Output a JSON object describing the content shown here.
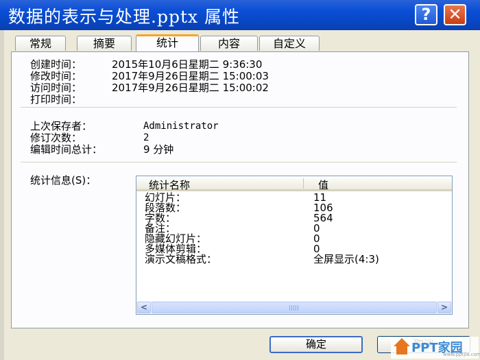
{
  "window": {
    "title": "数据的表示与处理.pptx 属性"
  },
  "titlebar_buttons": {
    "help": "?",
    "close": "✕"
  },
  "tabs": [
    {
      "label": "常规"
    },
    {
      "label": "摘要"
    },
    {
      "label": "统计"
    },
    {
      "label": "内容"
    },
    {
      "label": "自定义"
    }
  ],
  "active_tab": "统计",
  "dates": {
    "created_label": "创建时间：",
    "created_value": "2015年10月6日星期二 9:36:30",
    "modified_label": "修改时间：",
    "modified_value": "2017年9月26日星期二 15:00:03",
    "accessed_label": "访问时间：",
    "accessed_value": "2017年9月26日星期二 15:00:02",
    "printed_label": "打印时间："
  },
  "saving": {
    "last_saved_by_label": "上次保存者：",
    "last_saved_by_value": "Administrator",
    "revision_label": "修订次数：",
    "revision_value": "2",
    "edit_time_label": "编辑时间总计：",
    "edit_time_value": "9 分钟"
  },
  "stats": {
    "label": "统计信息(S)：",
    "columns": {
      "name": "统计名称",
      "value": "值"
    },
    "rows": [
      {
        "name": "幻灯片：",
        "value": "11"
      },
      {
        "name": "段落数：",
        "value": "106"
      },
      {
        "name": "字数：",
        "value": "564"
      },
      {
        "name": "备注：",
        "value": "0"
      },
      {
        "name": "隐藏幻灯片：",
        "value": "0"
      },
      {
        "name": "多媒体剪辑：",
        "value": "0"
      },
      {
        "name": "演示文稿格式：",
        "value": "全屏显示(4:3)"
      }
    ],
    "scroll_left": "<",
    "scroll_right": ">"
  },
  "buttons": {
    "ok": "确定",
    "cancel": "取消"
  },
  "watermark": {
    "text": "PPT家园",
    "sub": "www.pptjia.com"
  }
}
